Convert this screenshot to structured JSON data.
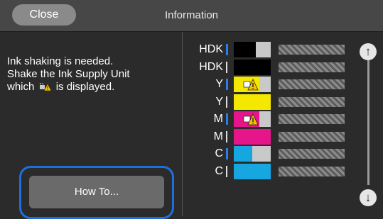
{
  "header": {
    "close_label": "Close",
    "title": "Information"
  },
  "message": {
    "line1": "Ink shaking is needed.",
    "line2": "Shake the Ink Supply Unit",
    "line3_before": "which",
    "line3_after": "is displayed."
  },
  "howto_label": "How To...",
  "inks": [
    {
      "label": "HDK",
      "color": "#000000",
      "level": 0.6,
      "indicator": "blue",
      "shake": false,
      "serial": "XXXXXXXX"
    },
    {
      "label": "HDK",
      "color": "#000000",
      "level": 1.0,
      "indicator": "white",
      "shake": false,
      "serial": "XXXXXXXX"
    },
    {
      "label": "Y",
      "color": "#f5e800",
      "level": 0.7,
      "indicator": "blue",
      "shake": true,
      "serial": "XXXXXXXX"
    },
    {
      "label": "Y",
      "color": "#f5e800",
      "level": 1.0,
      "indicator": "white",
      "shake": false,
      "serial": "XXXXXXXX"
    },
    {
      "label": "M",
      "color": "#e6158a",
      "level": 0.7,
      "indicator": "blue",
      "shake": true,
      "serial": "XXXXXXXX"
    },
    {
      "label": "M",
      "color": "#e6158a",
      "level": 1.0,
      "indicator": "white",
      "shake": false,
      "serial": "XXXXXXXX"
    },
    {
      "label": "C",
      "color": "#17a7e0",
      "level": 0.5,
      "indicator": "blue",
      "shake": false,
      "serial": "XXXXXXXX"
    },
    {
      "label": "C",
      "color": "#17a7e0",
      "level": 1.0,
      "indicator": "white",
      "shake": false,
      "serial": "XXXXXXXX"
    }
  ],
  "icons": {
    "scroll_up": "arrow-up-circle-icon",
    "scroll_down": "arrow-down-circle-icon",
    "shake": "shake-warning-icon"
  },
  "colors": {
    "highlight": "#1d6fe0",
    "indicator_blue": "#2d7de6"
  }
}
